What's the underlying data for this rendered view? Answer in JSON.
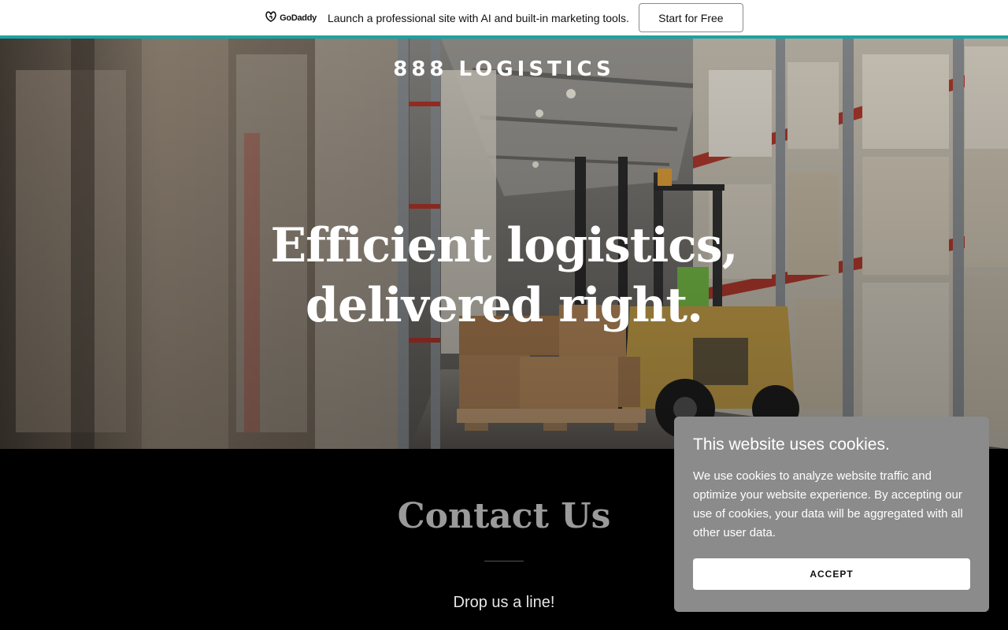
{
  "promo": {
    "logo_text": "GoDaddy",
    "message": "Launch a professional site with AI and built-in marketing tools.",
    "button_label": "Start for Free"
  },
  "hero": {
    "brand": "888 LOGISTICS",
    "headline": "Efficient logistics, delivered right."
  },
  "contact": {
    "title": "Contact Us",
    "subtitle": "Drop us a line!"
  },
  "cookie": {
    "title": "This website uses cookies.",
    "body": "We use cookies to analyze website traffic and optimize your website experience. By accepting our use of cookies, your data will be aggregated with all other user data.",
    "accept_label": "ACCEPT"
  },
  "colors": {
    "accent_bar": "#1ba3a3",
    "cookie_bg": "#8b8b8b",
    "contact_bg": "#000000"
  },
  "icons": {
    "promo_logo": "godaddy-logo-icon"
  }
}
